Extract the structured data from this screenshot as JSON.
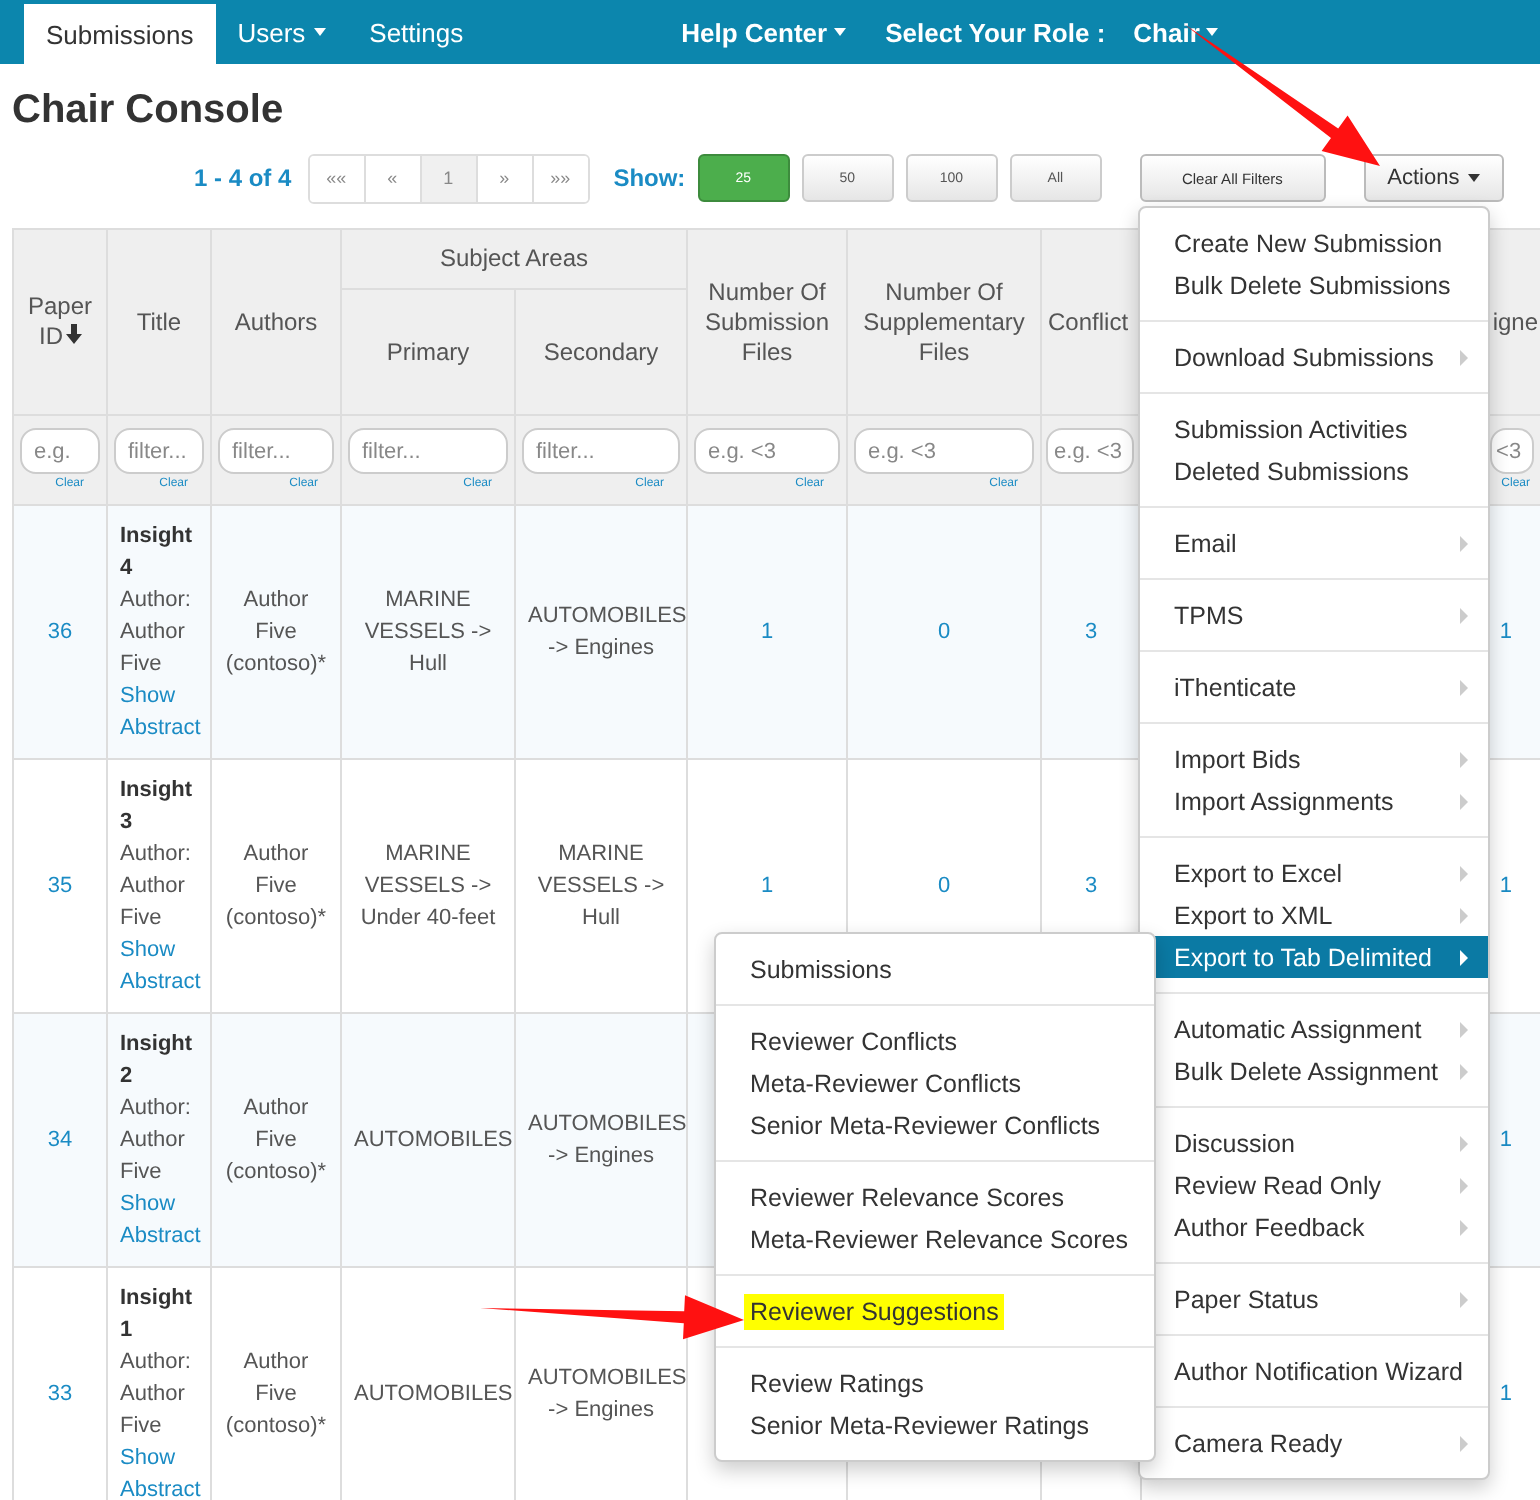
{
  "nav": {
    "items": [
      {
        "label": "Submissions",
        "selected": true,
        "caret": false
      },
      {
        "label": "Users",
        "selected": false,
        "caret": true
      },
      {
        "label": "Settings",
        "selected": false,
        "caret": false
      }
    ],
    "help_center": "Help Center",
    "role_prompt": "Select Your Role :",
    "role": "Chair"
  },
  "page_title": "Chair Console",
  "toolbar": {
    "range": "1 - 4 of 4",
    "pager": [
      {
        "label": "««",
        "selected": false
      },
      {
        "label": "«",
        "selected": false
      },
      {
        "label": "1",
        "selected": true
      },
      {
        "label": "»",
        "selected": false
      },
      {
        "label": "»»",
        "selected": false
      }
    ],
    "show_label": "Show:",
    "page_sizes": [
      {
        "label": "25",
        "selected": true
      },
      {
        "label": "50",
        "selected": false
      },
      {
        "label": "100",
        "selected": false
      },
      {
        "label": "All",
        "selected": false
      }
    ],
    "clear_filters": "Clear All Filters",
    "actions": "Actions"
  },
  "table": {
    "headers": {
      "paper_id": "Paper ID",
      "title": "Title",
      "authors": "Authors",
      "subject_areas": "Subject Areas",
      "primary": "Primary",
      "secondary": "Secondary",
      "submission_files": "Number Of Submission Files",
      "supplementary_files": "Number Of Supplementary Files",
      "conflicts": "Conflict",
      "column_9": "igne"
    },
    "filters": [
      {
        "placeholder": "e.g.",
        "clear": "Clear"
      },
      {
        "placeholder": "filter...",
        "clear": "Clear"
      },
      {
        "placeholder": "filter...",
        "clear": "Clear"
      },
      {
        "placeholder": "filter...",
        "clear": "Clear"
      },
      {
        "placeholder": "filter...",
        "clear": "Clear"
      },
      {
        "placeholder": "e.g. <3",
        "clear": "Clear"
      },
      {
        "placeholder": "e.g. <3",
        "clear": "Clear"
      },
      {
        "placeholder": "e.g. <3"
      },
      {
        "placeholder": "<3",
        "clear": "Clear"
      }
    ],
    "rows": [
      {
        "paper_id": "36",
        "title": "Insight 4",
        "author_line": "Author: Author Five",
        "link": "Show Abstract",
        "authors": "Author Five (contoso)*",
        "primary": "MARINE VESSELS -> Hull",
        "secondary": "AUTOMOBILES -> Engines",
        "submission_files": "1",
        "supplementary_files": "0",
        "conflicts": "3",
        "column_9": "1"
      },
      {
        "paper_id": "35",
        "title": "Insight 3",
        "author_line": "Author: Author Five",
        "link": "Show Abstract",
        "authors": "Author Five (contoso)*",
        "primary": "MARINE VESSELS -> Under 40-feet",
        "secondary": "MARINE VESSELS -> Hull",
        "submission_files": "1",
        "supplementary_files": "0",
        "conflicts": "3",
        "column_9": "1"
      },
      {
        "paper_id": "34",
        "title": "Insight 2",
        "author_line": "Author: Author Five",
        "link": "Show Abstract",
        "authors": "Author Five (contoso)*",
        "primary": "AUTOMOBILES",
        "secondary": "AUTOMOBILES -> Engines",
        "column_9": "1"
      },
      {
        "paper_id": "33",
        "title": "Insight 1",
        "author_line": "Author: Author Five",
        "link": "Show Abstract",
        "authors": "Author Five (contoso)*",
        "primary": "AUTOMOBILES",
        "secondary": "AUTOMOBILES -> Engines",
        "column_9": "1"
      }
    ]
  },
  "actions_menu": [
    [
      {
        "label": "Create New Submission",
        "submenu": false,
        "highlighted": false
      },
      {
        "label": "Bulk Delete Submissions",
        "submenu": false,
        "highlighted": false
      }
    ],
    [
      {
        "label": "Download Submissions",
        "submenu": true,
        "highlighted": false
      }
    ],
    [
      {
        "label": "Submission Activities",
        "submenu": false,
        "highlighted": false
      },
      {
        "label": "Deleted Submissions",
        "submenu": false,
        "highlighted": false
      }
    ],
    [
      {
        "label": "Email",
        "submenu": true,
        "highlighted": false
      }
    ],
    [
      {
        "label": "TPMS",
        "submenu": true,
        "highlighted": false
      }
    ],
    [
      {
        "label": "iThenticate",
        "submenu": true,
        "highlighted": false
      }
    ],
    [
      {
        "label": "Import Bids",
        "submenu": true,
        "highlighted": false
      },
      {
        "label": "Import Assignments",
        "submenu": true,
        "highlighted": false
      }
    ],
    [
      {
        "label": "Export to Excel",
        "submenu": true,
        "highlighted": false
      },
      {
        "label": "Export to XML",
        "submenu": true,
        "highlighted": false
      },
      {
        "label": "Export to Tab Delimited",
        "submenu": true,
        "highlighted": true
      }
    ],
    [
      {
        "label": "Automatic Assignment",
        "submenu": true,
        "highlighted": false
      },
      {
        "label": "Bulk Delete Assignment",
        "submenu": true,
        "highlighted": false
      }
    ],
    [
      {
        "label": "Discussion",
        "submenu": true,
        "highlighted": false
      },
      {
        "label": "Review Read Only",
        "submenu": true,
        "highlighted": false
      },
      {
        "label": "Author Feedback",
        "submenu": true,
        "highlighted": false
      }
    ],
    [
      {
        "label": "Paper Status",
        "submenu": true,
        "highlighted": false
      }
    ],
    [
      {
        "label": "Author Notification Wizard",
        "submenu": false,
        "highlighted": false
      }
    ],
    [
      {
        "label": "Camera Ready",
        "submenu": true,
        "highlighted": false
      }
    ]
  ],
  "export_submenu": [
    [
      {
        "label": "Submissions",
        "marked": false
      }
    ],
    [
      {
        "label": "Reviewer Conflicts",
        "marked": false
      },
      {
        "label": "Meta-Reviewer Conflicts",
        "marked": false
      },
      {
        "label": "Senior Meta-Reviewer Conflicts",
        "marked": false
      }
    ],
    [
      {
        "label": "Reviewer Relevance Scores",
        "marked": false
      },
      {
        "label": "Meta-Reviewer Relevance Scores",
        "marked": false
      }
    ],
    [
      {
        "label": "Reviewer Suggestions",
        "marked": true
      }
    ],
    [
      {
        "label": "Review Ratings",
        "marked": false
      },
      {
        "label": "Senior Meta-Reviewer Ratings",
        "marked": false
      }
    ]
  ]
}
